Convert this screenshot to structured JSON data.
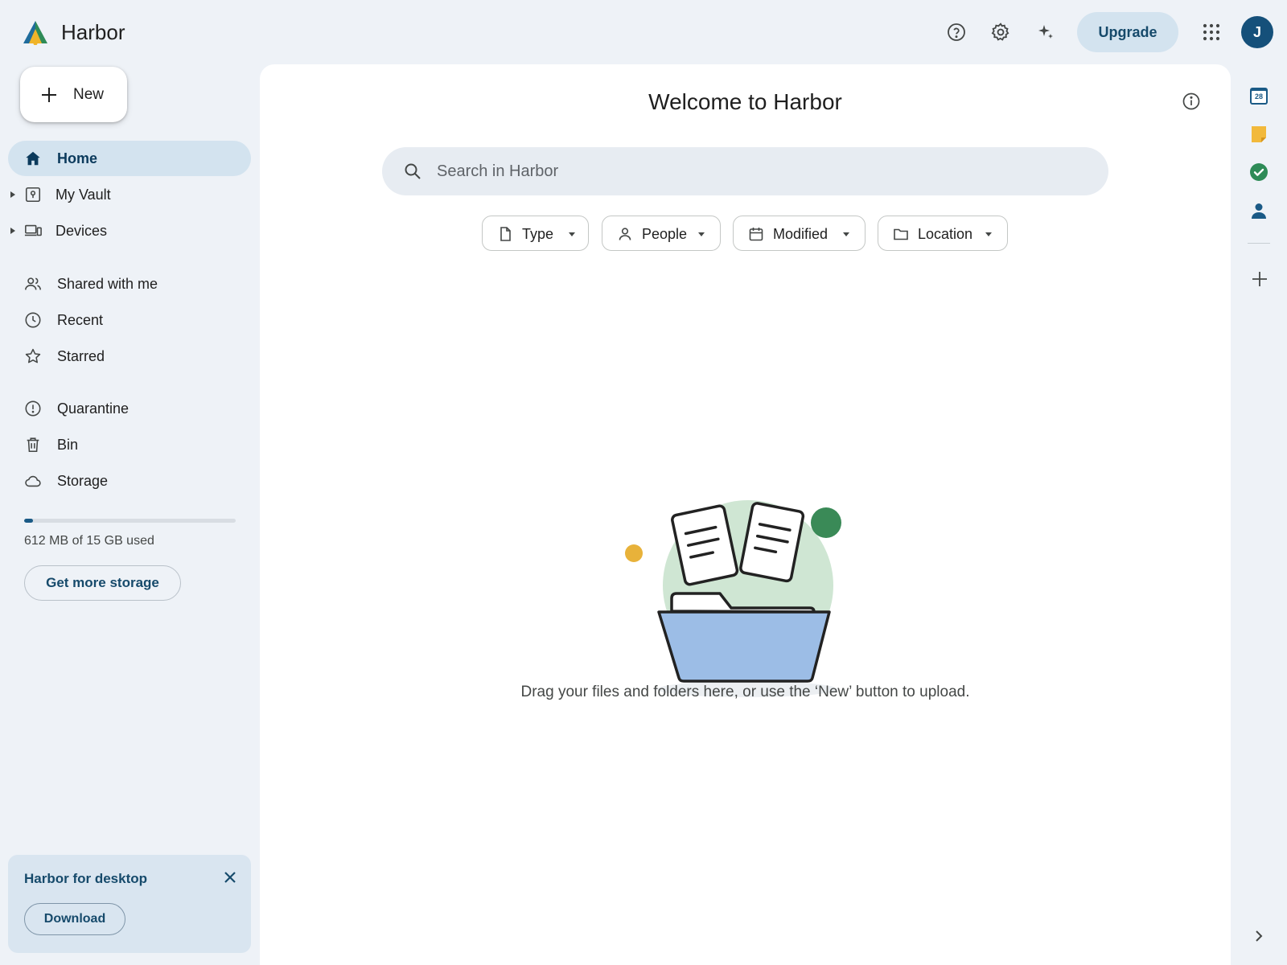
{
  "app": {
    "title": "Harbor"
  },
  "header": {
    "upgrade_label": "Upgrade",
    "avatar_initial": "J",
    "icons": [
      "help-icon",
      "settings-icon",
      "sparkle-icon",
      "apps-grid-icon"
    ]
  },
  "sidebar": {
    "new_label": "New",
    "items": [
      {
        "label": "Home",
        "icon": "home-icon",
        "active": true
      },
      {
        "label": "My Vault",
        "icon": "vault-icon"
      },
      {
        "label": "Devices",
        "icon": "devices-icon"
      },
      {
        "label": "Shared with me",
        "icon": "people-icon"
      },
      {
        "label": "Recent",
        "icon": "clock-icon"
      },
      {
        "label": "Starred",
        "icon": "star-icon"
      },
      {
        "label": "Quarantine",
        "icon": "alert-icon"
      },
      {
        "label": "Bin",
        "icon": "trash-icon"
      },
      {
        "label": "Storage",
        "icon": "cloud-icon"
      }
    ],
    "storage": {
      "used_text": "612 MB of 15 GB used",
      "used_fraction": 0.04,
      "more_storage_label": "Get more storage"
    },
    "desktop_card": {
      "title": "Harbor for desktop",
      "download_label": "Download"
    }
  },
  "main": {
    "welcome": "Welcome to Harbor",
    "search_placeholder": "Search in Harbor",
    "filters": [
      {
        "label": "Type",
        "icon": "file-icon"
      },
      {
        "label": "People",
        "icon": "person-icon"
      },
      {
        "label": "Modified",
        "icon": "calendar-icon"
      },
      {
        "label": "Location",
        "icon": "folder-icon"
      }
    ],
    "empty_message": "Drag your files and folders here, or use the ‘New’ button to upload."
  },
  "right_rail": {
    "calendar_day": "28",
    "apps": [
      "calendar-icon",
      "notes-icon",
      "tasks-icon",
      "contacts-icon"
    ]
  },
  "colors": {
    "accent": "#164a6b",
    "active_bg": "#d3e3ef",
    "page_bg": "#eef2f7"
  }
}
